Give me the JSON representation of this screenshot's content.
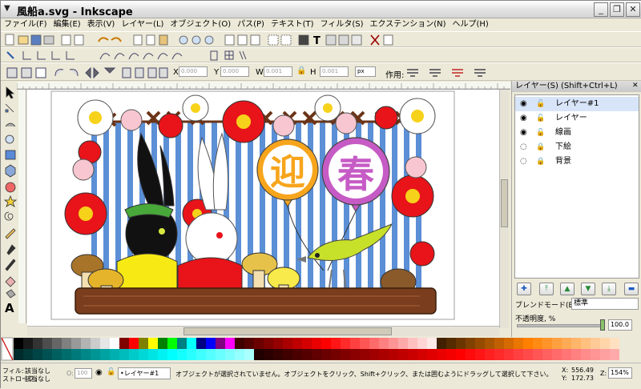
{
  "window": {
    "title": "風船a.svg - Inkscape",
    "minimize": "_",
    "restore": "❐",
    "close": "✕"
  },
  "menu": [
    "ファイル(F)",
    "編集(E)",
    "表示(V)",
    "レイヤー(L)",
    "オブジェクト(O)",
    "パス(P)",
    "テキスト(T)",
    "フィルタ(S)",
    "エクステンション(N)",
    "ヘルプ(H)"
  ],
  "tool_controls": {
    "x_label": "X",
    "x_value": "0.000",
    "y_label": "Y",
    "y_value": "0.000",
    "w_label": "W",
    "w_value": "0.001",
    "h_label": "H",
    "h_value": "0.001",
    "unit": "px",
    "affect_label": "作用:"
  },
  "canvas": {
    "char_1": "迎",
    "char_2": "春"
  },
  "layers_panel": {
    "title": "レイヤー(S) (Shift+Ctrl+L)",
    "layers": [
      {
        "name": "レイヤー#1"
      },
      {
        "name": "レイヤー"
      },
      {
        "name": "線画"
      },
      {
        "name": "下絵"
      },
      {
        "name": "背景"
      }
    ],
    "blend_label": "ブレンドモード(B)",
    "blend_value": "標準",
    "opacity_label": "不透明度, %",
    "opacity_value": "100.0"
  },
  "status": {
    "fill_label": "フィル:",
    "stroke_label": "ストローク:",
    "fill_value": "該当なし",
    "stroke_value": "該当なし",
    "opacity_label": "O:",
    "opacity_value": "100",
    "current_layer": "•レイヤー#1",
    "message": "オブジェクトが選択されていません。オブジェクトをクリック、Shift+クリック、または囲むようにドラッグして選択して下さい。",
    "x_label": "X:",
    "x_value": "556.49",
    "y_label": "Y:",
    "y_value": "172.73",
    "zoom_label": "Z:",
    "zoom_value": "154%"
  },
  "colors": {
    "stripe_blue": "#5b8fd6",
    "balloon_orange": "#f7a51c",
    "balloon_purple": "#c65bc5",
    "plum_red": "#e8141a",
    "bird_green": "#c7e02a",
    "shelf_brown": "#7a3e1e"
  }
}
